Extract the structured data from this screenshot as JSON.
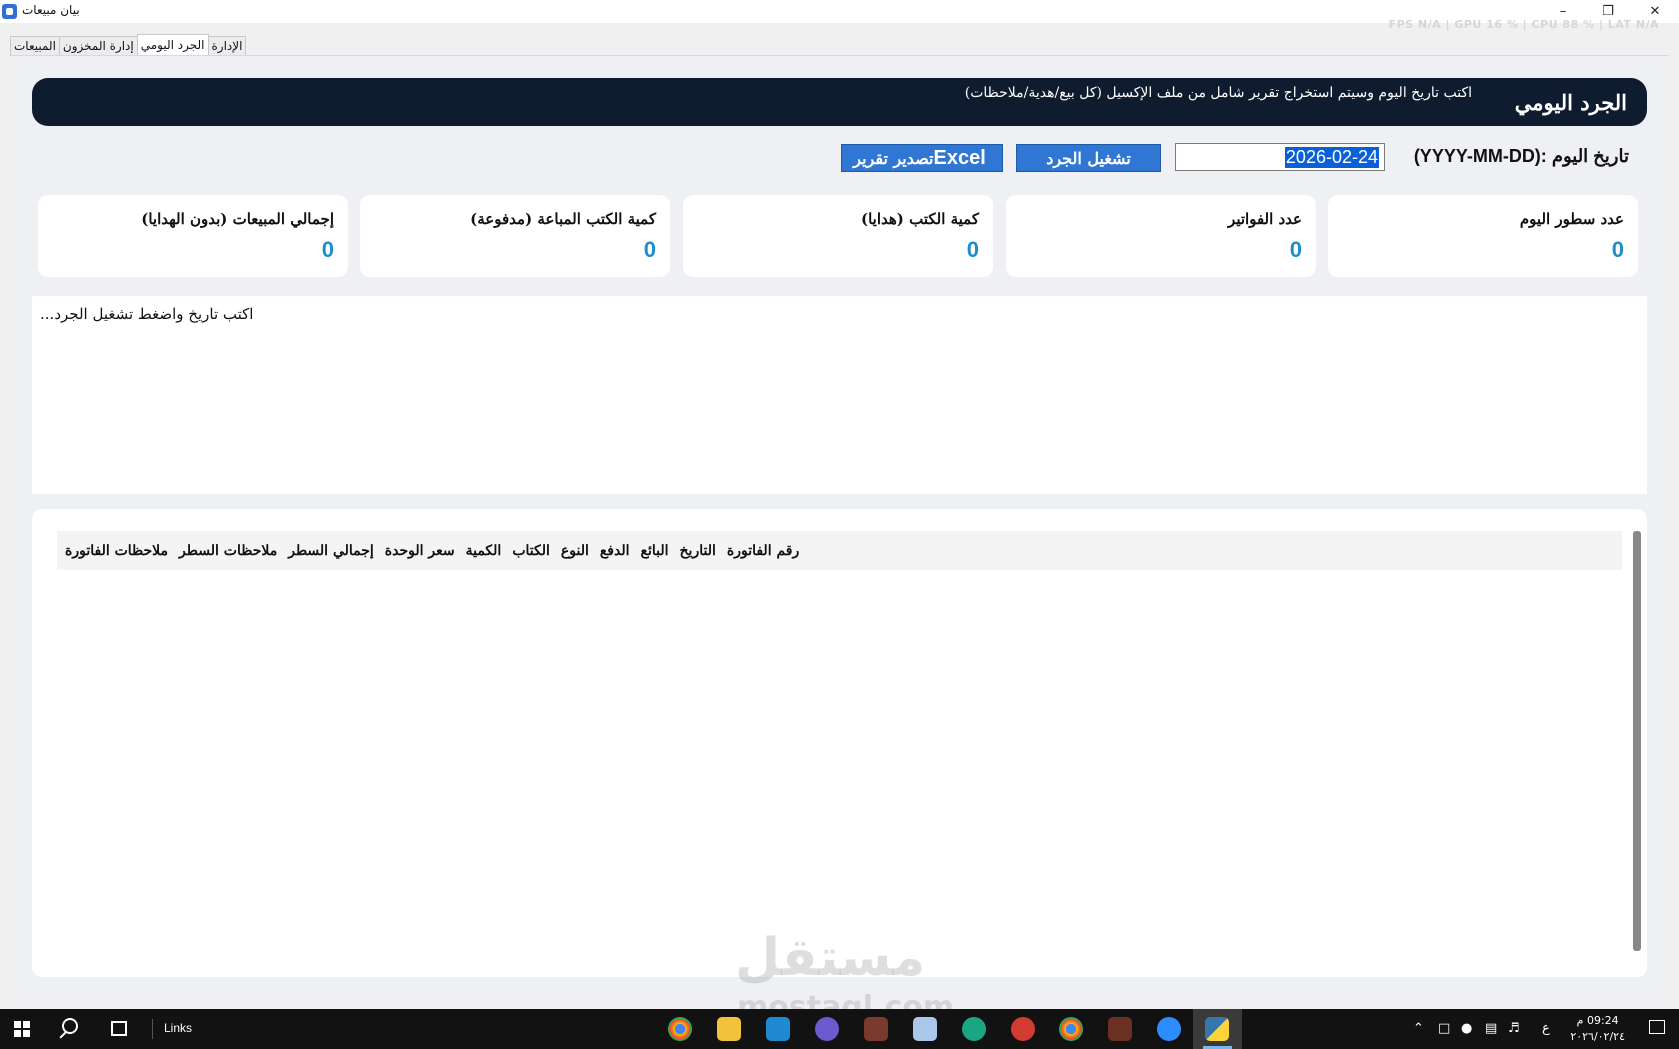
{
  "window": {
    "title": "بيان مبيعات",
    "overlay_stats": "FPS N/A  |  GPU 16 %  |  CPU 88 %  |  LAT N/A"
  },
  "tabs": [
    {
      "label": "المبيعات"
    },
    {
      "label": "إدارة المخزون"
    },
    {
      "label": "الجرد اليومي"
    },
    {
      "label": "الإدارة"
    }
  ],
  "banner": {
    "title": "الجرد اليومي",
    "subtitle": "اكتب تاريخ اليوم وسيتم استخراج تقرير شامل من ملف الإكسيل (كل بيع/هدية/ملاحظات)"
  },
  "controls": {
    "date_label": "(YYYY-MM-DD): تاريخ اليوم",
    "date_value": "2026-02-24",
    "run_button": "تشغيل الجرد",
    "export_button_word": "Excel",
    "export_button_label": "تصدير تقرير"
  },
  "cards": [
    {
      "label": "عدد سطور اليوم",
      "value": "0"
    },
    {
      "label": "عدد الفواتير",
      "value": "0"
    },
    {
      "label": "كمية الكتب (هدايا)",
      "value": "0"
    },
    {
      "label": "كمية الكتب المباعة (مدفوعة)",
      "value": "0"
    },
    {
      "label": "إجمالي المبيعات (بدون الهدايا)",
      "value": "0"
    }
  ],
  "log": {
    "text": "...اكتب تاريخ واضغط تشغيل الجرد"
  },
  "table": {
    "columns": [
      "رقم الفاتورة",
      "التاريخ",
      "البائع",
      "الدفع",
      "النوع",
      "الكتاب",
      "الكمية",
      "سعر الوحدة",
      "إجمالي السطر",
      "ملاحظات السطر",
      "ملاحظات الفاتورة"
    ],
    "rows": []
  },
  "watermark": {
    "brand": "مستقل",
    "url": "mostaql.com"
  },
  "taskbar": {
    "links_label": "Links",
    "language": "ع",
    "time": "09:24 م",
    "date": "٢٠٢٦/٠٢/٢٤"
  },
  "colors": {
    "banner_bg": "#0f1c30",
    "button_bg": "#2f77d3",
    "stat_value": "#1b8fc9"
  }
}
